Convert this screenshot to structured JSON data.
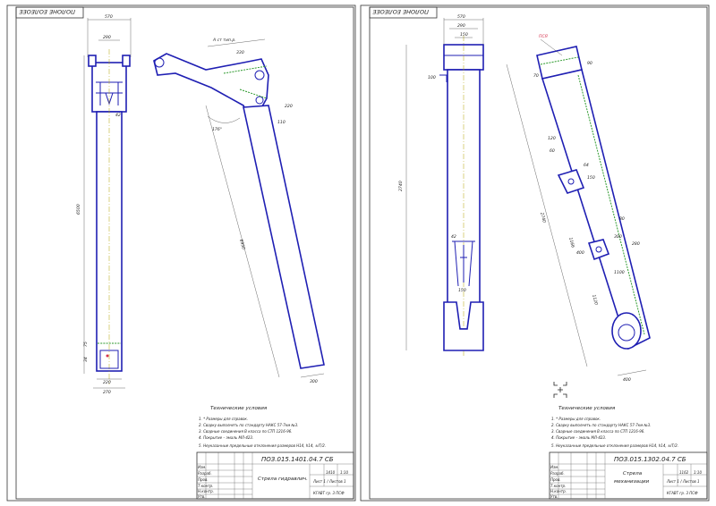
{
  "sheets": [
    {
      "stamp_top": "ПОЛОНЕ ЕОЛЕОЕЕ",
      "tech_title": "Технические условия",
      "notes": [
        "1. * Размеры для справок.",
        "2. Сварку выполнять по стандарту НАКС 57-7км №3.",
        "3. Сварные соединения В класса по СТП 1216-96.",
        "4. Покрытие – эмаль МЛ-423.",
        "5. Неуказанные предельные отклонения размеров Н14, h14, ±IT/2."
      ],
      "doc_code": "ПОЗ.015.1401.04.7 СБ",
      "name": "Стрела гидравлич.",
      "mass": "1410",
      "scale": "1:10",
      "sheet_info": "Лист 1 / Листов 1",
      "org": "КГАВТ гр. 3 ПСФ",
      "role_labels": [
        "Изм.",
        "Разраб.",
        "Пров.",
        "Т.контр.",
        "Н.контр.",
        "Утв."
      ],
      "dims": {
        "top_width": "570",
        "inner_width": "290",
        "length": "6500",
        "dim_42": "42",
        "dim_75": "75",
        "dim_34": "34",
        "bottom_270": "270",
        "bottom_220": "220",
        "angled_length": "6950",
        "angle": "176°",
        "section_a": "А ст тип.р.",
        "d_330": "330",
        "d_220": "220",
        "d_110": "110",
        "d_300": "300"
      }
    },
    {
      "stamp_top": "ПОЛОНЕ ЕОЛЕОЕЕ",
      "tech_title": "Технические условия",
      "notes": [
        "1. * Размеры для справок.",
        "2. Сварку выполнять по стандарту НАКС 57-7км №3.",
        "3. Сварные соединения В класса по СТП 1216-96.",
        "4. Покрытие – эмаль МЛ-423.",
        "5. Неуказанные предельные отклонения размеров Н14, h14, ±IT/2."
      ],
      "doc_code": "ПОЗ.015.1302.04.7 СБ",
      "name_line1": "Стрела",
      "name_line2": "механизации",
      "mass": "1162",
      "scale": "1:10",
      "sheet_info": "Лист 1 / Листов 1",
      "org": "КГАВТ гр. 3 ПСФ",
      "role_labels": [
        "Изм.",
        "Разраб.",
        "Пров.",
        "Т.контр.",
        "Н.контр.",
        "Утв."
      ],
      "dims": {
        "top_width": "570",
        "inner_width": "290",
        "inner_150": "150",
        "left_100": "100",
        "length": "2740",
        "dim_42": "42",
        "dim_150b": "150",
        "diag_length": "2740",
        "red_label": "ПСЯ",
        "d_70": "70",
        "d_90": "90",
        "d_60": "60",
        "d_64": "64",
        "d_120": "120",
        "d_150": "150",
        "d_1100": "1100",
        "d_1166": "1166",
        "d_400": "400",
        "d_300": "300",
        "d_280": "280",
        "d_1120": "1120",
        "d_80": "80",
        "d_400b": "400"
      }
    }
  ]
}
